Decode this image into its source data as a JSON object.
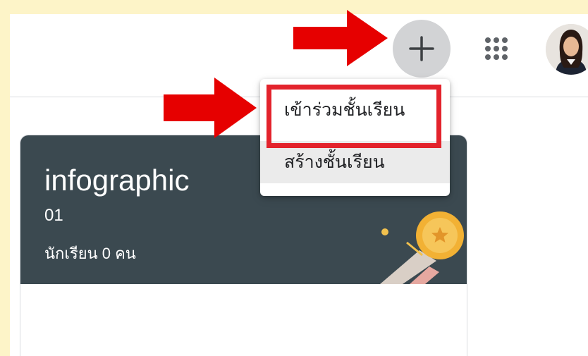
{
  "header": {
    "add_button": {
      "icon": "plus-icon"
    },
    "apps_button": {
      "icon": "apps-grid-icon"
    },
    "avatar": {
      "icon": "user-avatar"
    }
  },
  "add_menu": {
    "items": [
      {
        "label": "เข้าร่วมชั้นเรียน",
        "highlighted": true
      },
      {
        "label": "สร้างชั้นเรียน",
        "highlighted": false
      }
    ]
  },
  "class_card": {
    "title": "infographic",
    "section": "01",
    "students": "นักเรียน 0 คน"
  },
  "annotations": {
    "arrow_color": "#e60000",
    "highlight_color": "#e3232c"
  }
}
